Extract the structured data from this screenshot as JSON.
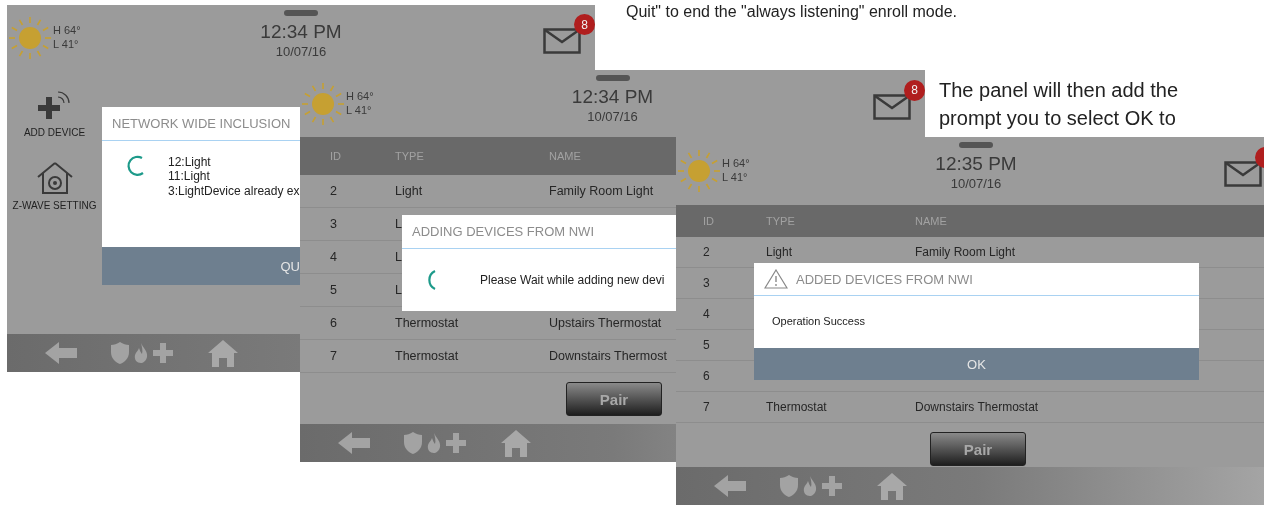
{
  "captions": [
    {
      "lines": [
        "Quit\" to end the \"always listening\" enroll mode."
      ]
    },
    {
      "lines": [
        "The panel will then add the",
        "prompt you to select OK to"
      ]
    }
  ],
  "panels": [
    {
      "weather": {
        "high": "H 64°",
        "low": "L 41°"
      },
      "time": "12:34 PM",
      "date": "10/07/16",
      "mail": {
        "badge": "8"
      },
      "body": {
        "kind": "launcher",
        "tiles": [
          {
            "kind": "add",
            "label": "ADD DEVICE"
          },
          {
            "kind": "settings",
            "label": "Z-WAVE SETTING"
          }
        ],
        "dialog": {
          "kind": "progress",
          "title": "NETWORK WIDE INCLUSION",
          "lines": [
            "12:Light",
            "11:Light",
            "3:LightDevice already ex"
          ],
          "button": "QU"
        }
      }
    },
    {
      "weather": {
        "high": "H 64°",
        "low": "L 41°"
      },
      "time": "12:34 PM",
      "date": "10/07/16",
      "mail": {
        "badge": "8"
      },
      "body": {
        "kind": "table",
        "columns": [
          "ID",
          "TYPE",
          "NAME"
        ],
        "rows": [
          {
            "cells": [
              "2",
              "Light",
              "Family Room Light"
            ]
          },
          {
            "cells": [
              "3",
              "L"
            ]
          },
          {
            "cells": [
              "4",
              "L"
            ]
          },
          {
            "cells": [
              "5",
              "L"
            ]
          },
          {
            "cells": [
              "6",
              "Thermostat",
              "Upstairs Thermostat"
            ]
          },
          {
            "cells": [
              "7",
              "Thermostat",
              "Downstairs Thermost"
            ]
          }
        ],
        "dialog": {
          "kind": "progress",
          "title": "ADDING DEVICES FROM NWI",
          "lines": [
            "Please Wait while adding new devi"
          ]
        },
        "pair_button": "Pair"
      }
    },
    {
      "weather": {
        "high": "H 64°",
        "low": "L 41°"
      },
      "time": "12:35 PM",
      "date": "10/07/16",
      "mail": {
        "badge_dot": true
      },
      "body": {
        "kind": "table",
        "columns": [
          "ID",
          "TYPE",
          "NAME"
        ],
        "rows": [
          {
            "cells": [
              "2",
              "Light",
              "Family Room Light"
            ]
          },
          {
            "cells": [
              "3"
            ]
          },
          {
            "cells": [
              "4"
            ]
          },
          {
            "cells": [
              "5"
            ]
          },
          {
            "cells": [
              "6"
            ]
          },
          {
            "cells": [
              "7",
              "Thermostat",
              "Downstairs Thermostat"
            ]
          }
        ],
        "dialog": {
          "kind": "alert",
          "title": "ADDED DEVICES FROM NWI",
          "lines": [
            "Operation Success"
          ],
          "button": "OK"
        },
        "pair_button": "Pair"
      }
    }
  ]
}
